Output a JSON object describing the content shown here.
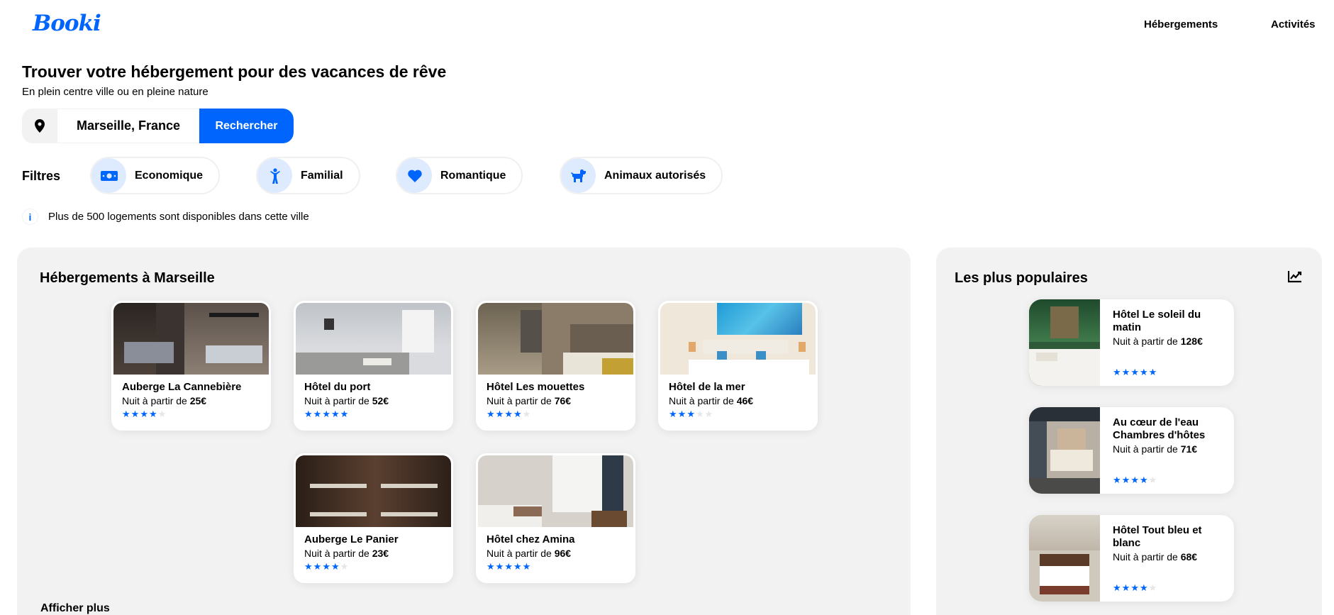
{
  "header": {
    "logo": "Booki",
    "nav": [
      {
        "label": "Hébergements"
      },
      {
        "label": "Activités"
      }
    ]
  },
  "hero": {
    "title": "Trouver votre hébergement pour des vacances de rêve",
    "subtitle": "En plein centre ville ou en pleine nature"
  },
  "search": {
    "value": "Marseille, France",
    "button_label": "Rechercher",
    "icon": "location-pin-icon"
  },
  "filters": {
    "label": "Filtres",
    "items": [
      {
        "label": "Economique",
        "icon": "money-bill-icon"
      },
      {
        "label": "Familial",
        "icon": "child-icon"
      },
      {
        "label": "Romantique",
        "icon": "heart-icon"
      },
      {
        "label": "Animaux autorisés",
        "icon": "dog-icon"
      }
    ]
  },
  "info": {
    "icon": "info-icon",
    "text": "Plus de 500 logements sont disponibles dans cette ville"
  },
  "accommodations": {
    "title": "Hébergements à Marseille",
    "price_prefix": "Nuit à partir de",
    "items": [
      {
        "name": "Auberge La Cannebière",
        "price": "25€",
        "rating": 4
      },
      {
        "name": "Hôtel du port",
        "price": "52€",
        "rating": 5
      },
      {
        "name": "Hôtel Les mouettes",
        "price": "76€",
        "rating": 4
      },
      {
        "name": "Hôtel de la mer",
        "price": "46€",
        "rating": 3
      },
      {
        "name": "Auberge Le Panier",
        "price": "23€",
        "rating": 4
      },
      {
        "name": "Hôtel chez Amina",
        "price": "96€",
        "rating": 5
      }
    ],
    "show_more": "Afficher plus"
  },
  "popular": {
    "title": "Les plus populaires",
    "icon": "trending-chart-icon",
    "price_prefix": "Nuit à partir de",
    "items": [
      {
        "name": "Hôtel Le soleil du matin",
        "price": "128€",
        "rating": 5
      },
      {
        "name": "Au cœur de l'eau Chambres d'hôtes",
        "price": "71€",
        "rating": 4
      },
      {
        "name": "Hôtel Tout bleu et blanc",
        "price": "68€",
        "rating": 4
      }
    ]
  },
  "colors": {
    "accent": "#0065FC",
    "accent_light": "#DEEBFF",
    "panel_bg": "#F2F2F2"
  }
}
